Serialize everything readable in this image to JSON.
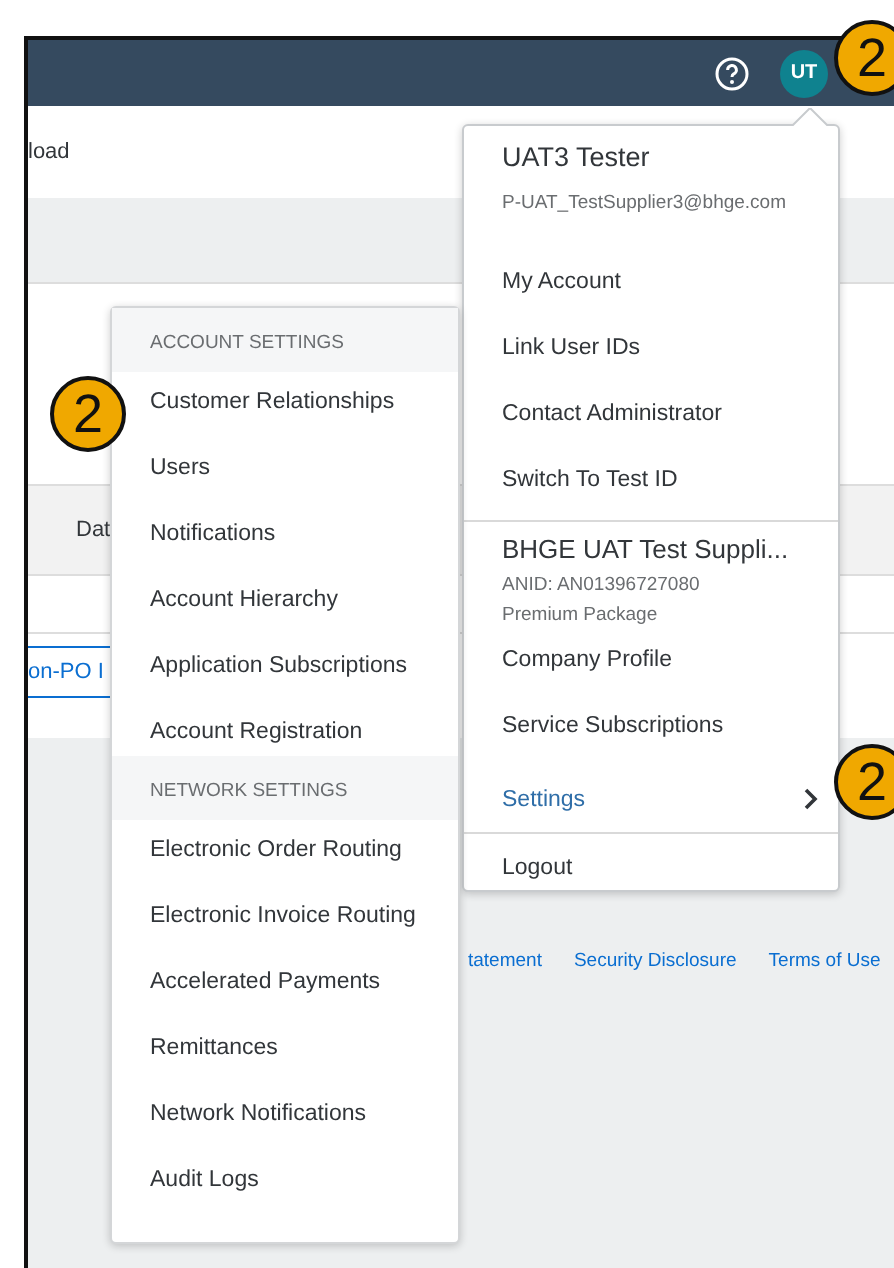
{
  "header": {
    "avatar": "UT"
  },
  "page": {
    "tab_text": "load",
    "column_header": "Dat",
    "tab_link": "on-PO I"
  },
  "footer_links": [
    "tatement",
    "Security Disclosure",
    "Terms of Use"
  ],
  "account_menu": {
    "user_name": "UAT3 Tester",
    "email": "P-UAT_TestSupplier3@bhge.com",
    "user_links": [
      {
        "label": "My Account"
      },
      {
        "label": "Link User IDs"
      },
      {
        "label": "Contact Administrator"
      },
      {
        "label": "Switch To Test ID"
      }
    ],
    "company": {
      "name": "BHGE UAT Test Suppli...",
      "anid": "ANID: AN01396727080",
      "package": "Premium Package"
    },
    "company_links": [
      {
        "label": "Company Profile",
        "kind": "link"
      },
      {
        "label": "Service Subscriptions",
        "kind": "link"
      },
      {
        "label": "Settings",
        "kind": "submenu",
        "expanded": true
      }
    ],
    "logout": "Logout"
  },
  "settings_menu": {
    "groups": [
      {
        "heading": "ACCOUNT SETTINGS",
        "items": [
          "Customer Relationships",
          "Users",
          "Notifications",
          "Account Hierarchy",
          "Application Subscriptions",
          "Account Registration"
        ]
      },
      {
        "heading": "NETWORK SETTINGS",
        "items": [
          "Electronic Order Routing",
          "Electronic Invoice Routing",
          "Accelerated Payments",
          "Remittances",
          "Network Notifications",
          "Audit Logs"
        ]
      }
    ]
  },
  "callouts": [
    {
      "text": "2"
    },
    {
      "text": "2"
    },
    {
      "text": "2"
    }
  ]
}
